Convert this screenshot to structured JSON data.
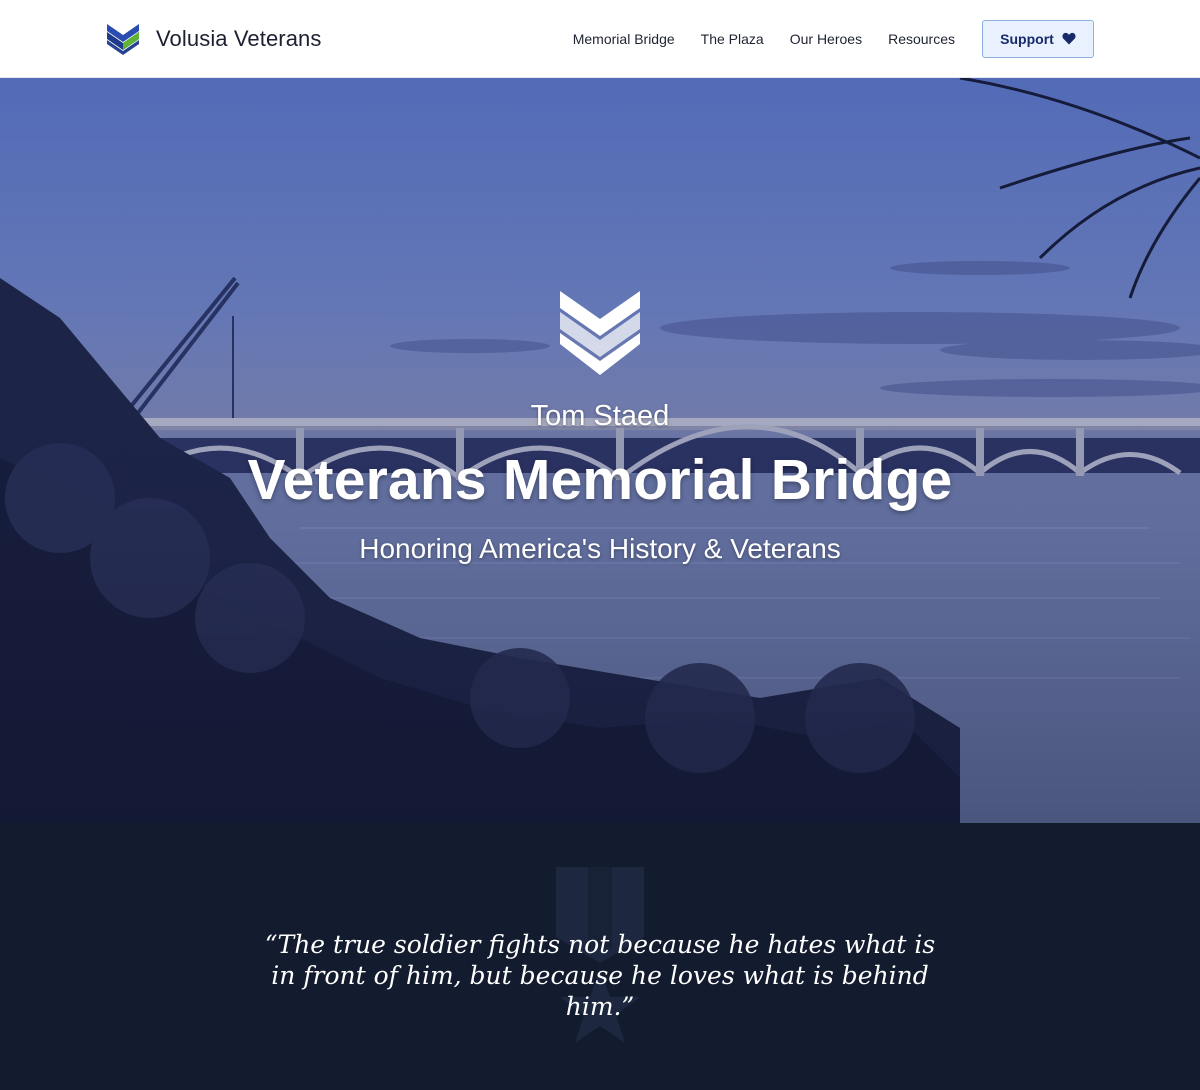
{
  "header": {
    "brand_name": "Volusia Veterans",
    "brand_icon": "chevron-logo-icon",
    "nav": [
      {
        "label": "Memorial Bridge"
      },
      {
        "label": "The Plaza"
      },
      {
        "label": "Our Heroes"
      },
      {
        "label": "Resources"
      }
    ],
    "support_label": "Support",
    "support_icon": "heart-icon"
  },
  "hero": {
    "emblem_icon": "chevron-emblem-icon",
    "eyebrow": "Tom Staed",
    "title": "Veterans Memorial Bridge",
    "subtitle": "Honoring America's History & Veterans"
  },
  "quote": {
    "text": "“The true soldier fights not because he hates what is in front of him, but because he loves what is behind him.”",
    "watermark_icon": "medal-icon"
  },
  "colors": {
    "logo_blue": "#1e3a8a",
    "logo_green": "#5fb336",
    "support_bg": "#e8f1fd",
    "support_text": "#172a6a",
    "quote_bg": "#131b2e"
  }
}
